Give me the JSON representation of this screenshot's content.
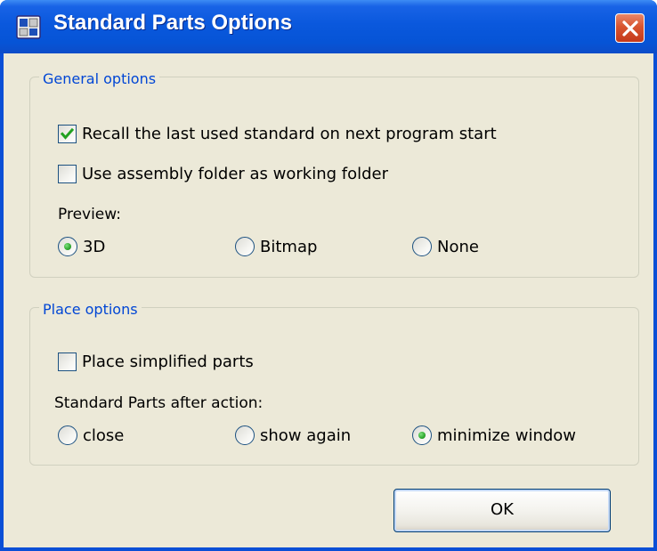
{
  "window": {
    "title": "Standard Parts Options",
    "icon": "app-icon",
    "close_icon": "close-icon"
  },
  "general": {
    "legend": "General options",
    "recall_label": "Recall the last used standard on next program start",
    "recall_checked": true,
    "assembly_label": "Use assembly folder as working folder",
    "assembly_checked": false,
    "preview_label": "Preview:",
    "preview_options": [
      "3D",
      "Bitmap",
      "None"
    ],
    "preview_selected": "3D"
  },
  "place": {
    "legend": "Place options",
    "simplified_label": "Place simplified parts",
    "simplified_checked": false,
    "after_action_label": "Standard Parts after action:",
    "after_action_options": [
      "close",
      "show again",
      "minimize window"
    ],
    "after_action_selected": "minimize window"
  },
  "buttons": {
    "ok_label": "OK"
  },
  "colors": {
    "titlebar": "#0a58dd",
    "legend_text": "#0046d5",
    "dialog_bg": "#ece9d8",
    "close_button": "#d8542f",
    "check_mark": "#21a121"
  }
}
